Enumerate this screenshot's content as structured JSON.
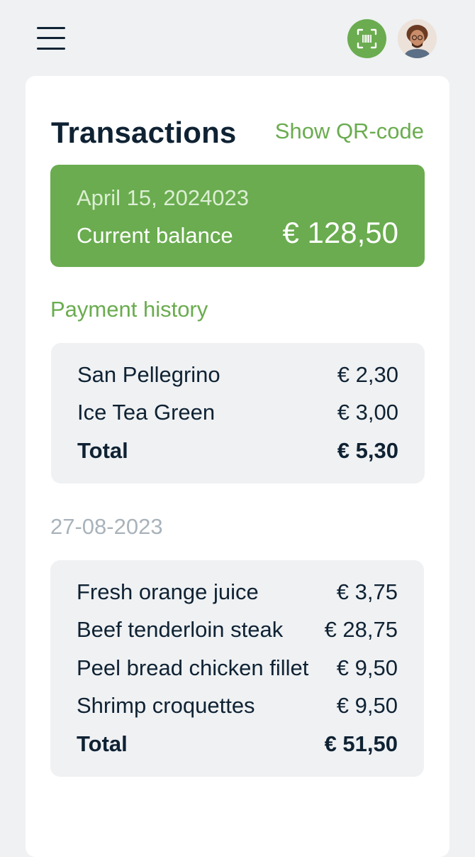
{
  "header": {
    "menu_icon": "hamburger-menu-icon",
    "scan_icon": "barcode-scan-icon",
    "accent_color": "#6aac4f"
  },
  "page": {
    "title": "Transactions",
    "qr_link": "Show QR-code"
  },
  "balance": {
    "date": "April 15, 2024023",
    "label": "Current balance",
    "amount": "€ 128,50"
  },
  "history": {
    "heading": "Payment history",
    "groups": [
      {
        "date": "",
        "items": [
          {
            "name": "San Pellegrino",
            "price": "€ 2,30"
          },
          {
            "name": "Ice Tea Green",
            "price": "€ 3,00"
          }
        ],
        "total_label": "Total",
        "total": "€ 5,30"
      },
      {
        "date": "27-08-2023",
        "items": [
          {
            "name": "Fresh orange juice",
            "price": "€ 3,75"
          },
          {
            "name": "Beef tenderloin steak",
            "price": "€ 28,75"
          },
          {
            "name": "Peel bread chicken fillet",
            "price": "€ 9,50"
          },
          {
            "name": "Shrimp croquettes",
            "price": "€ 9,50"
          }
        ],
        "total_label": "Total",
        "total": "€ 51,50"
      }
    ]
  }
}
